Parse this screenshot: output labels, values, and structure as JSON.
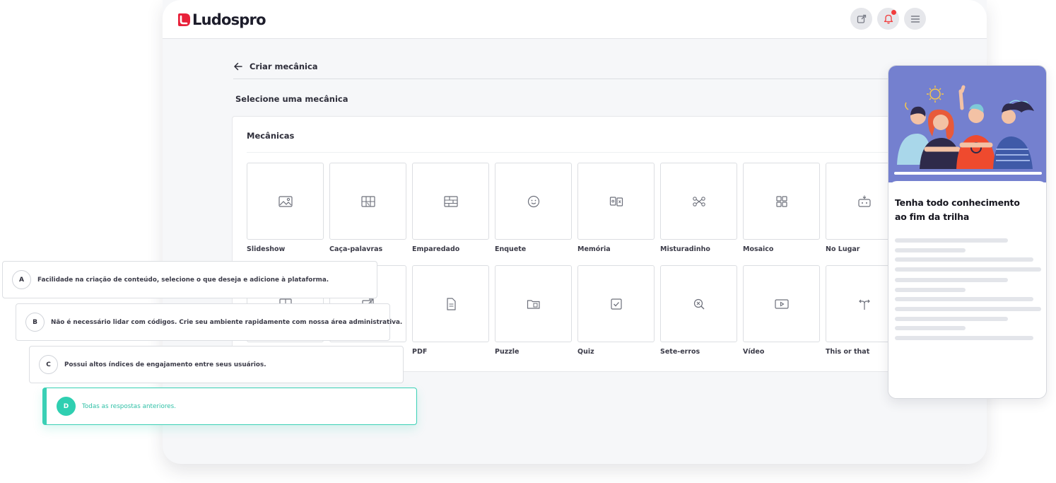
{
  "brand": {
    "name": "Ludospro",
    "accent": "#e8213a",
    "teal": "#2fcfb1",
    "hero_bg": "#7480cf"
  },
  "header": {
    "icons": [
      "external-link-icon",
      "bell-icon",
      "menu-icon"
    ],
    "has_notification": true
  },
  "breadcrumb": {
    "back_label": "Criar mecânica"
  },
  "section_title": "Selecione uma mecânica",
  "panel": {
    "title": "Mecânicas",
    "items": [
      {
        "label": "Slideshow",
        "icon": "image-icon"
      },
      {
        "label": "Caça-palavras",
        "icon": "word-grid-icon"
      },
      {
        "label": "Emparedado",
        "icon": "wall-icon"
      },
      {
        "label": "Enquete",
        "icon": "smile-icon"
      },
      {
        "label": "Memória",
        "icon": "memory-cards-icon"
      },
      {
        "label": "Misturadinho",
        "icon": "shuffle-nodes-icon"
      },
      {
        "label": "Mosaico",
        "icon": "mosaic-icon"
      },
      {
        "label": "No Lugar",
        "icon": "drop-box-icon"
      },
      {
        "label": "",
        "icon": "columns-icon"
      },
      {
        "label": "",
        "icon": "arrow-box-icon"
      },
      {
        "label": "PDF",
        "icon": "document-icon"
      },
      {
        "label": "Puzzle",
        "icon": "puzzle-folder-icon"
      },
      {
        "label": "Quiz",
        "icon": "checkbox-icon"
      },
      {
        "label": "Sete-erros",
        "icon": "zoom-x-icon"
      },
      {
        "label": "Vídeo",
        "icon": "play-icon"
      },
      {
        "label": "This or that",
        "icon": "fork-arrow-icon"
      }
    ]
  },
  "phone": {
    "title": "Tenha todo conhecimento ao fim da trilha"
  },
  "options": [
    {
      "letter": "A",
      "text": "Facilidade na criação de conteúdo, selecione o que deseja e adicione à plataforma.",
      "selected": false
    },
    {
      "letter": "B",
      "text": "Não é necessário lidar com códigos. Crie seu ambiente rapidamente com nossa área administrativa.",
      "selected": false
    },
    {
      "letter": "C",
      "text": "Possui altos índices de engajamento entre seus usuários.",
      "selected": false
    },
    {
      "letter": "D",
      "text": "Todas as respostas anteriores.",
      "selected": true
    }
  ]
}
